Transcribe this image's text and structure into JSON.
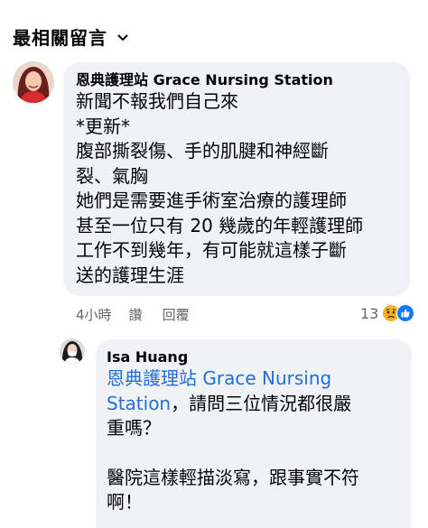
{
  "sort": {
    "label": "最相關留言",
    "icon": "chevron-down-icon"
  },
  "comments": [
    {
      "author": "恩典護理站 Grace Nursing Station",
      "avatar": "profile-photo",
      "lines": [
        "新聞不報我們自己來",
        "*更新*",
        "腹部撕裂傷、手的肌腱和神經斷",
        "裂、氣胸",
        "她們是需要進手術室治療的護理師",
        "甚至一位只有 20 幾歲的年輕護理師",
        "工作不到幾年，有可能就這樣子斷",
        "送的護理生涯"
      ],
      "time": "4小時",
      "like_label": "讚",
      "reply_label": "回覆",
      "reaction_count": "13",
      "reaction_icons": [
        "sad-reaction-icon",
        "like-reaction-icon"
      ]
    },
    {
      "author": "Isa Huang",
      "avatar": "profile-photo",
      "mention_line1": "恩典護理站 Grace Nursing",
      "mention_line2": "Station",
      "text_after_mention": "，請問三位情況都很嚴",
      "lines": [
        "重嗎？",
        "",
        "醫院這樣輕描淡寫，跟事實不符",
        "啊！"
      ]
    }
  ],
  "colors": {
    "bubble_bg": "#f0f2f5",
    "mention": "#216fdb",
    "meta_text": "#65676b",
    "like_blue": "#1877f2",
    "sad_yellow": "#f7b125"
  }
}
